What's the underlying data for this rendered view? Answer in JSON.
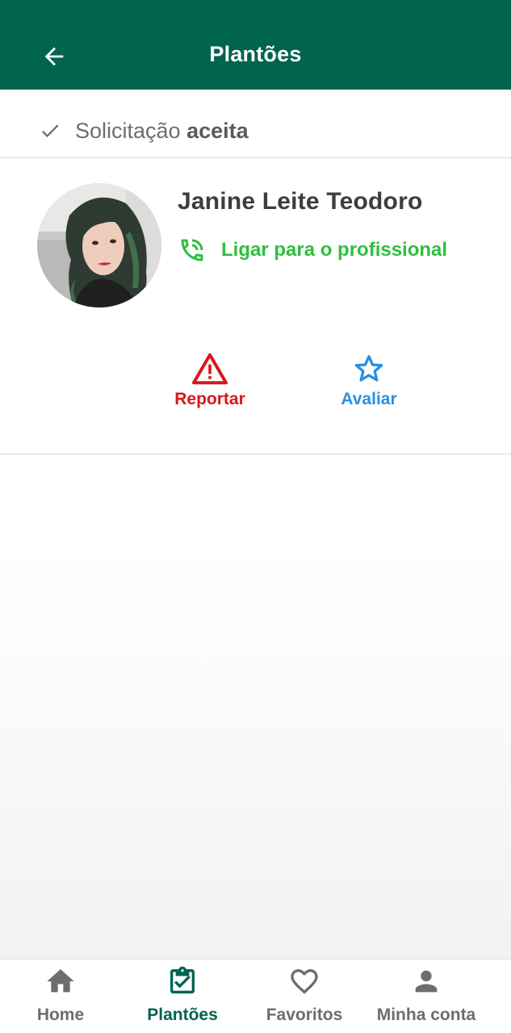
{
  "header": {
    "title": "Plantões",
    "back_icon": "arrow-left-icon",
    "background_color": "#00644f"
  },
  "status": {
    "icon": "check-icon",
    "label_prefix": "Solicitação",
    "label_strong": "aceita"
  },
  "professional": {
    "name": "Janine Leite Teodoro",
    "call_label": "Ligar para o profissional",
    "call_icon": "phone-in-talk-icon",
    "call_color": "#2fbf3f"
  },
  "actions": {
    "report_label": "Reportar",
    "report_icon": "warning-triangle-icon",
    "report_color": "#d9161e",
    "rate_label": "Avaliar",
    "rate_icon": "star-outline-icon",
    "rate_color": "#2a8fe0"
  },
  "bottom_nav": {
    "items": [
      {
        "label": "Home",
        "icon": "home-icon",
        "active": false
      },
      {
        "label": "Plantões",
        "icon": "clipboard-check-icon",
        "active": true
      },
      {
        "label": "Favoritos",
        "icon": "heart-outline-icon",
        "active": false
      },
      {
        "label": "Minha conta",
        "icon": "account-icon",
        "active": false
      }
    ],
    "active_color": "#00644f",
    "inactive_color": "#6d6d6d"
  }
}
